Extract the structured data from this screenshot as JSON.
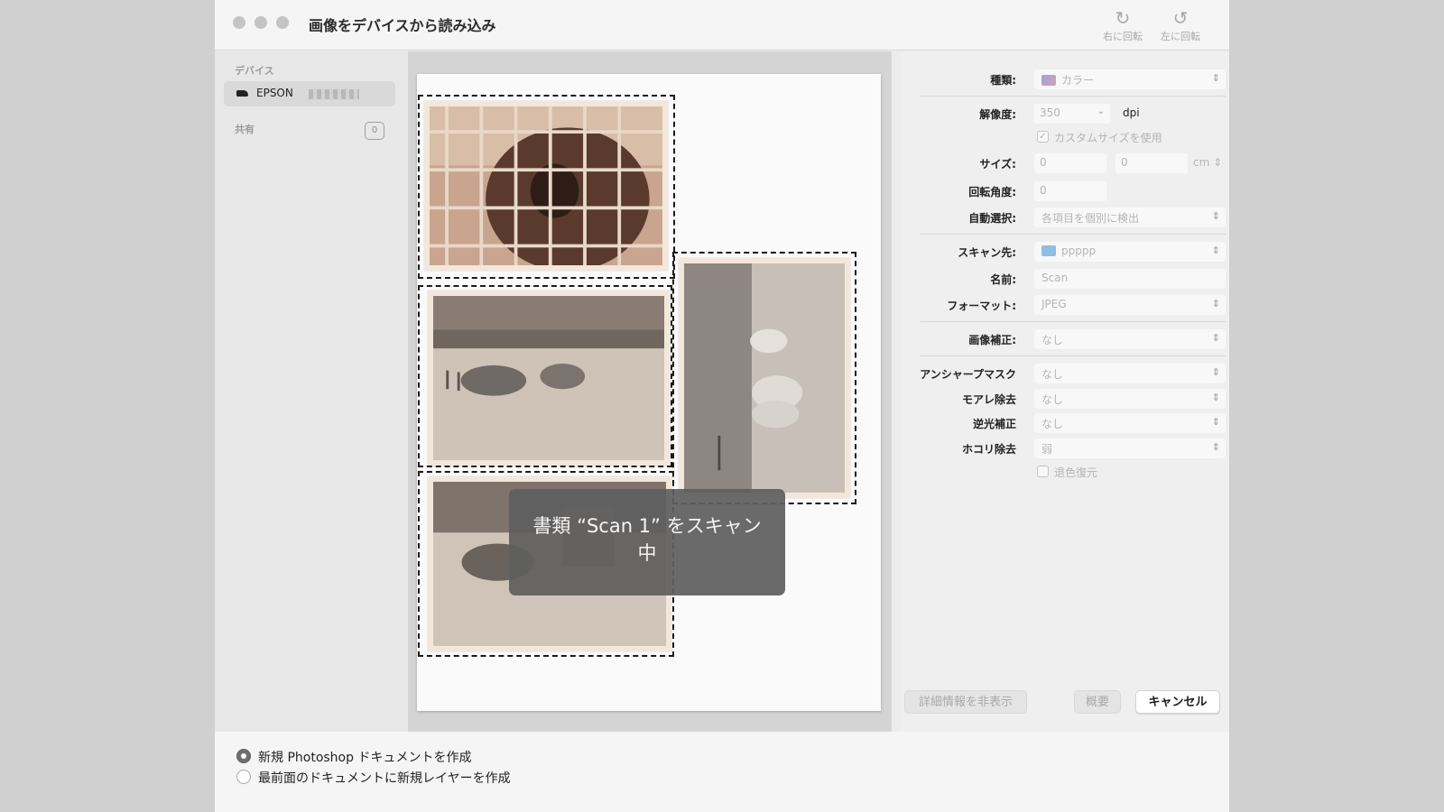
{
  "window": {
    "title": "画像をデバイスから読み込み",
    "rotate_right_label": "右に回転",
    "rotate_left_label": "左に回転"
  },
  "sidebar": {
    "devices_header": "デバイス",
    "device_name": "EPSON",
    "shared_header": "共有",
    "shared_count": "0"
  },
  "overlay": {
    "scanning_message": "書類 “Scan 1” をスキャン中"
  },
  "settings": {
    "kind_label": "種類:",
    "kind_value": "カラー",
    "resolution_label": "解像度:",
    "resolution_value": "350",
    "resolution_unit": "dpi",
    "custom_size_label": "カスタムサイズを使用",
    "custom_size_checked": true,
    "size_label": "サイズ:",
    "size_width": "0",
    "size_height": "0",
    "size_unit": "cm",
    "rotation_label": "回転角度:",
    "rotation_value": "0",
    "auto_select_label": "自動選択:",
    "auto_select_value": "各項目を個別に検出",
    "scan_to_label": "スキャン先:",
    "scan_to_value": "ppppp",
    "name_label": "名前:",
    "name_value": "Scan",
    "format_label": "フォーマット:",
    "format_value": "JPEG",
    "image_correction_label": "画像補正:",
    "image_correction_value": "なし",
    "unsharp_mask_label": "アンシャープマスク",
    "unsharp_mask_value": "なし",
    "moire_label": "モアレ除去",
    "moire_value": "なし",
    "backlight_label": "逆光補正",
    "backlight_value": "なし",
    "dust_label": "ホコリ除去",
    "dust_value": "弱",
    "fade_restore_label": "退色復元",
    "fade_restore_checked": false
  },
  "buttons": {
    "hide_details": "詳細情報を非表示",
    "overview": "概要",
    "cancel": "キャンセル"
  },
  "bottom": {
    "option_new_doc": "新規 Photoshop ドキュメントを作成",
    "option_new_layer": "最前面のドキュメントに新規レイヤーを作成",
    "selected_option": "option_new_doc"
  }
}
